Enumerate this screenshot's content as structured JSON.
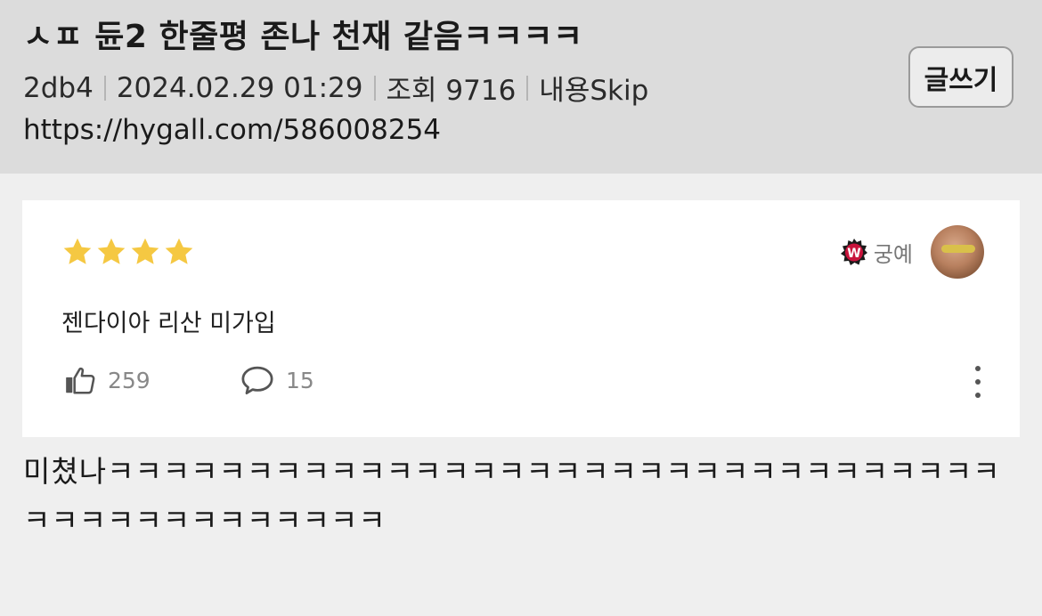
{
  "post": {
    "title": "ㅅㅍ 듄2 한줄평 존나 천재 같음ㅋㅋㅋㅋ",
    "author": "2db4",
    "date": "2024.02.29 01:29",
    "views": "조회 9716",
    "skip": "내용Skip",
    "url": "https://hygall.com/586008254",
    "write_label": "글쓰기",
    "body": "미쳤나ㅋㅋㅋㅋㅋㅋㅋㅋㅋㅋㅋㅋㅋㅋㅋㅋㅋㅋㅋㅋㅋㅋㅋㅋㅋㅋㅋㅋㅋㅋㅋㅋㅋㅋㅋㅋㅋㅋㅋㅋㅋㅋㅋㅋㅋ"
  },
  "review": {
    "rating": 4,
    "star_color": "#f5c842",
    "reviewer_name": "궁예",
    "badge_letter": "W",
    "badge_color": "#c8143c",
    "text": "젠다이아 리산 미가입",
    "likes": "259",
    "comments": "15"
  }
}
